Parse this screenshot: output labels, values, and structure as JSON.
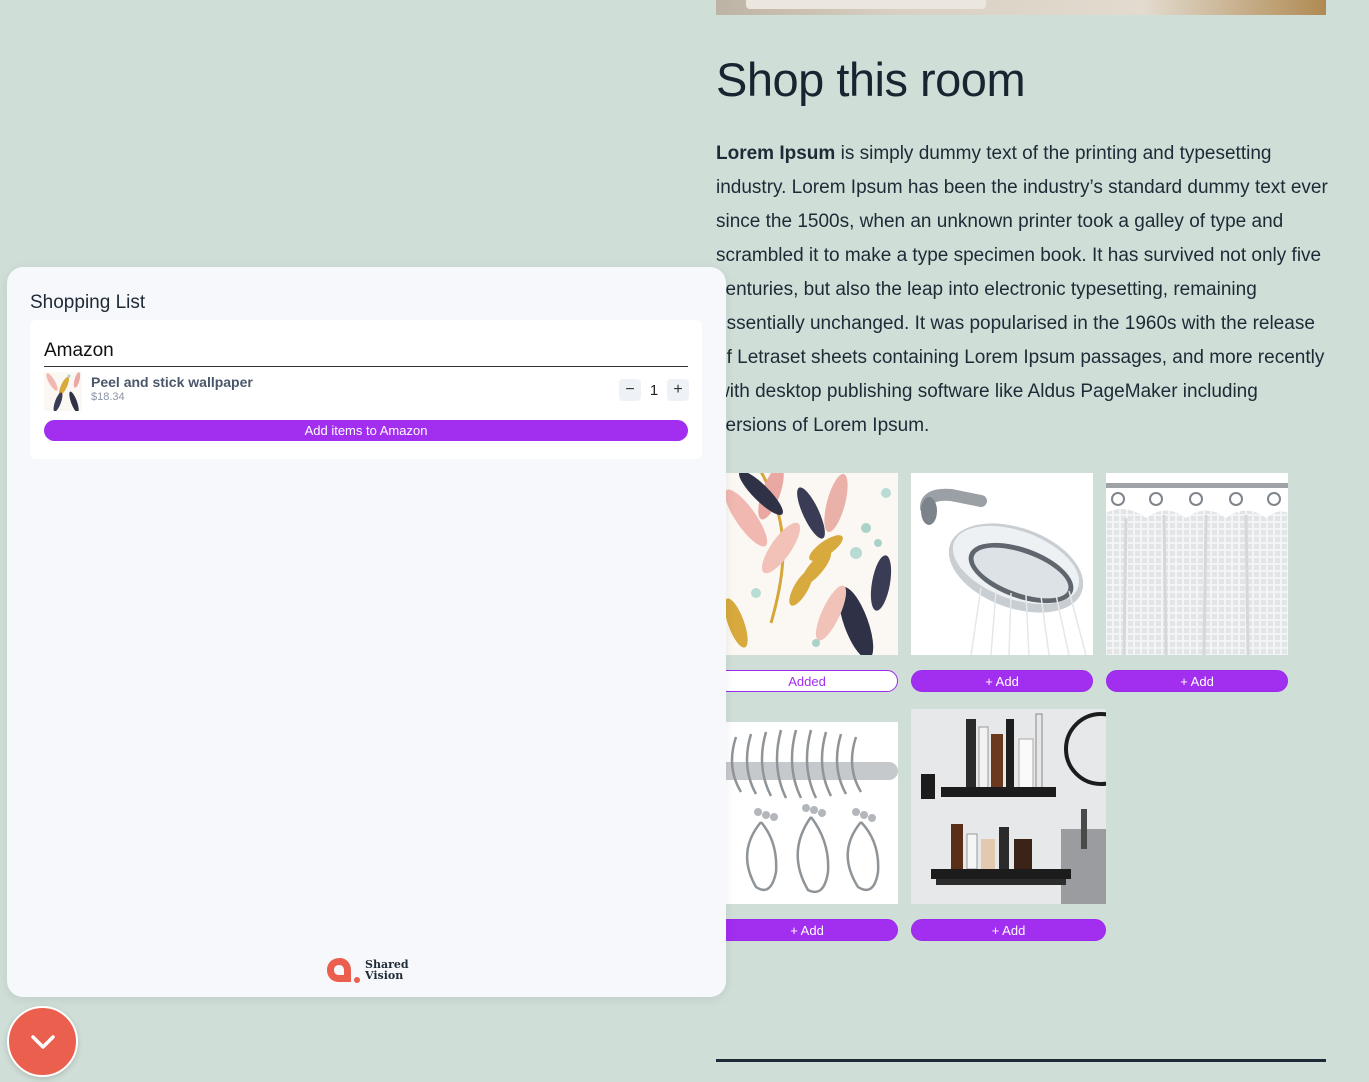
{
  "page": {
    "title": "Shop this room",
    "description_lead": "Lorem Ipsum",
    "description_rest": " is simply dummy text of the printing and typesetting industry. Lorem Ipsum has been the industry’s standard dummy text ever since the 1500s, when an unknown printer took a galley of type and scrambled it to make a type specimen book. It has survived not only five centuries, but also the leap into electronic typesetting, remaining essentially unchanged. It was popularised in the 1960s with the release of Letraset sheets containing Lorem Ipsum passages, and more recently with desktop publishing software like Aldus PageMaker including versions of Lorem Ipsum."
  },
  "products": [
    {
      "name": "wallpaper",
      "button": "Added",
      "added": true
    },
    {
      "name": "shower-head",
      "button": "+ Add",
      "added": false
    },
    {
      "name": "shower-curtain",
      "button": "+ Add",
      "added": false
    },
    {
      "name": "curtain-rings",
      "button": "+ Add",
      "added": false
    },
    {
      "name": "bathroom-shelf",
      "button": "+ Add",
      "added": false
    }
  ],
  "shopping_list": {
    "title": "Shopping List",
    "store": "Amazon",
    "items": [
      {
        "name": "Peel and stick wallpaper",
        "price": "$18.34",
        "quantity": "1"
      }
    ],
    "decrement_label": "−",
    "increment_label": "+",
    "checkout_label": "Add items to Amazon",
    "brand_line1": "Shared",
    "brand_line2": "Vision"
  },
  "icons": {
    "collapse": "chevron-down-icon",
    "brand": "shared-vision-logo"
  },
  "colors": {
    "background": "#cfded7",
    "accent": "#a22ef0",
    "fab": "#eb5f4e"
  }
}
